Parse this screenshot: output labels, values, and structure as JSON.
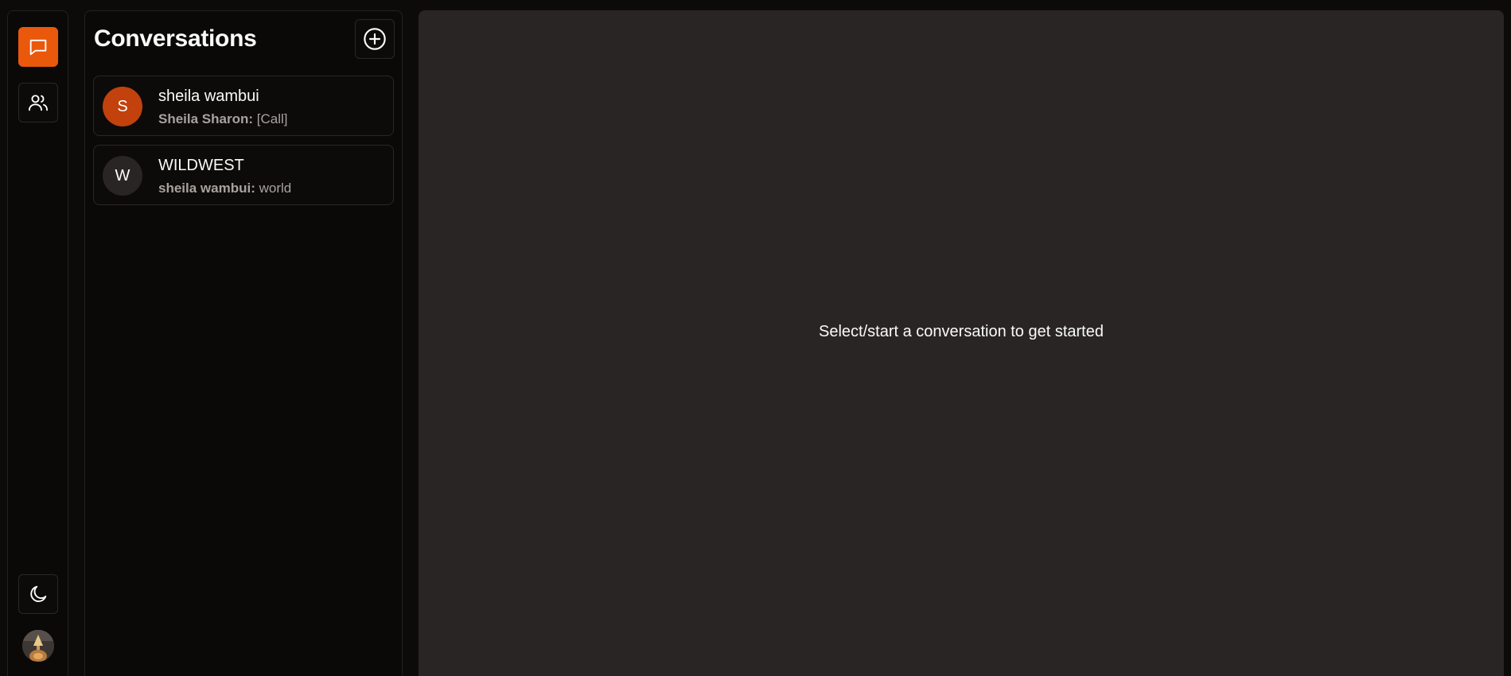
{
  "rail": {
    "items": [
      {
        "icon": "chat-bubble-icon",
        "active": true
      },
      {
        "icon": "users-icon",
        "active": false
      }
    ],
    "theme_toggle_icon": "moon-icon",
    "accent": "#ea580c"
  },
  "conversations": {
    "title": "Conversations",
    "new_button_icon": "plus-circle-icon",
    "items": [
      {
        "initial": "S",
        "avatar_color": "#c2410c",
        "name": "sheila wambui",
        "sender": "Sheila Sharon:",
        "message": "[Call]"
      },
      {
        "initial": "W",
        "avatar_color": "#292524",
        "name": "WILDWEST",
        "sender": "sheila wambui:",
        "message": "world"
      }
    ]
  },
  "main": {
    "empty_message": "Select/start a conversation to get started"
  }
}
